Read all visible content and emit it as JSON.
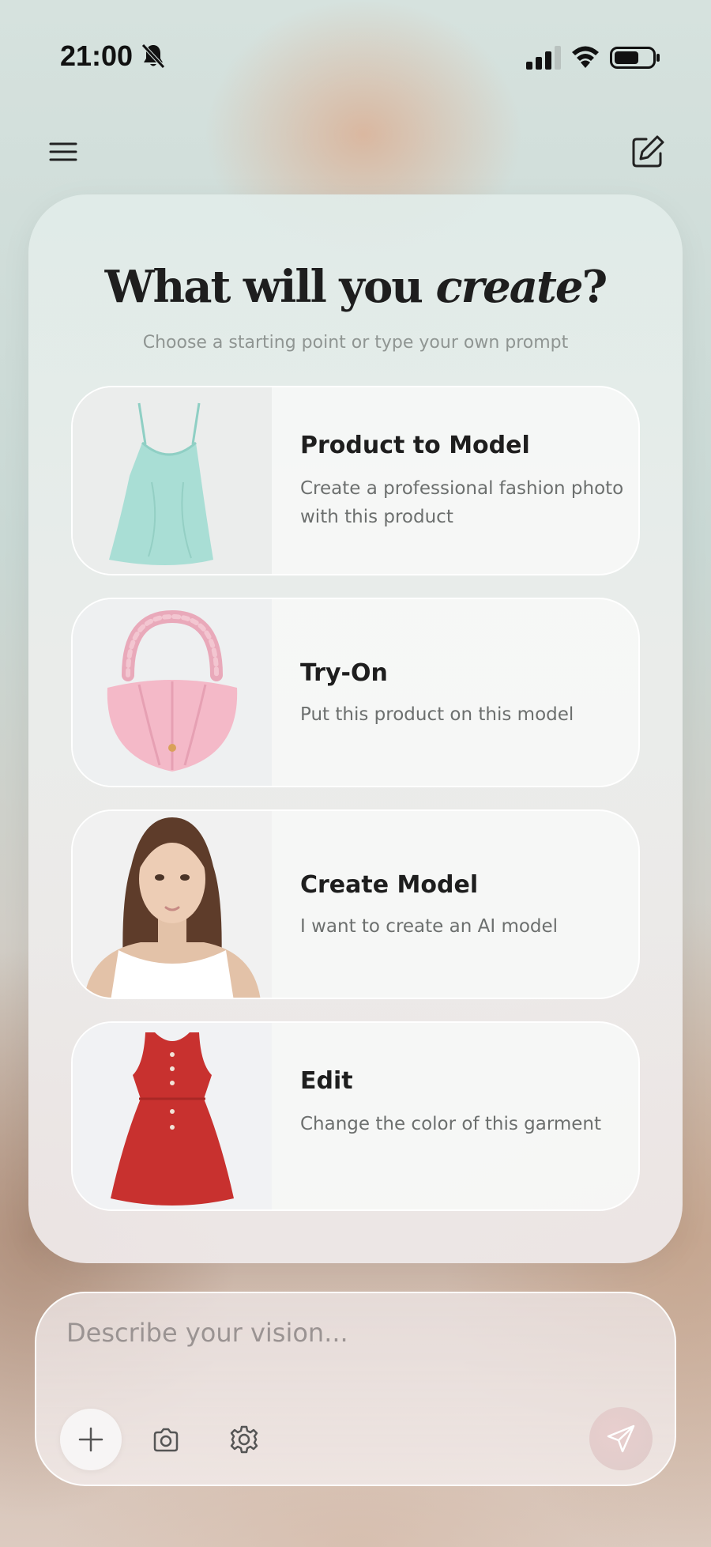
{
  "status_bar": {
    "time": "21:00",
    "icons": [
      "bell-off-icon",
      "signal-icon",
      "wifi-icon",
      "battery-icon"
    ]
  },
  "nav": {
    "menu_icon": "hamburger-menu-icon",
    "compose_icon": "compose-icon"
  },
  "hero": {
    "title_plain": "What will you ",
    "title_italic": "create",
    "title_end": "?",
    "subtitle": "Choose a starting point or type your own prompt"
  },
  "cards": [
    {
      "title": "Product to Model",
      "description": "Create a professional fashion photo with this product",
      "image": "mint-camisole-top"
    },
    {
      "title": "Try-On",
      "description": "Put this product on this model",
      "image": "pink-hobo-bag"
    },
    {
      "title": "Create Model",
      "description": "I want to create an AI model",
      "image": "female-model-portrait"
    },
    {
      "title": "Edit",
      "description": "Change the color of this garment",
      "image": "red-sleeveless-dress"
    }
  ],
  "composer": {
    "placeholder": "Describe your vision...",
    "buttons": [
      "plus-icon",
      "camera-icon",
      "settings-gear-icon",
      "send-icon"
    ]
  },
  "colors": {
    "title_text": "#1e1e1e",
    "subtitle_text": "#8f9592",
    "description_text": "#6c6f6e",
    "placeholder_text": "#9a9392"
  }
}
